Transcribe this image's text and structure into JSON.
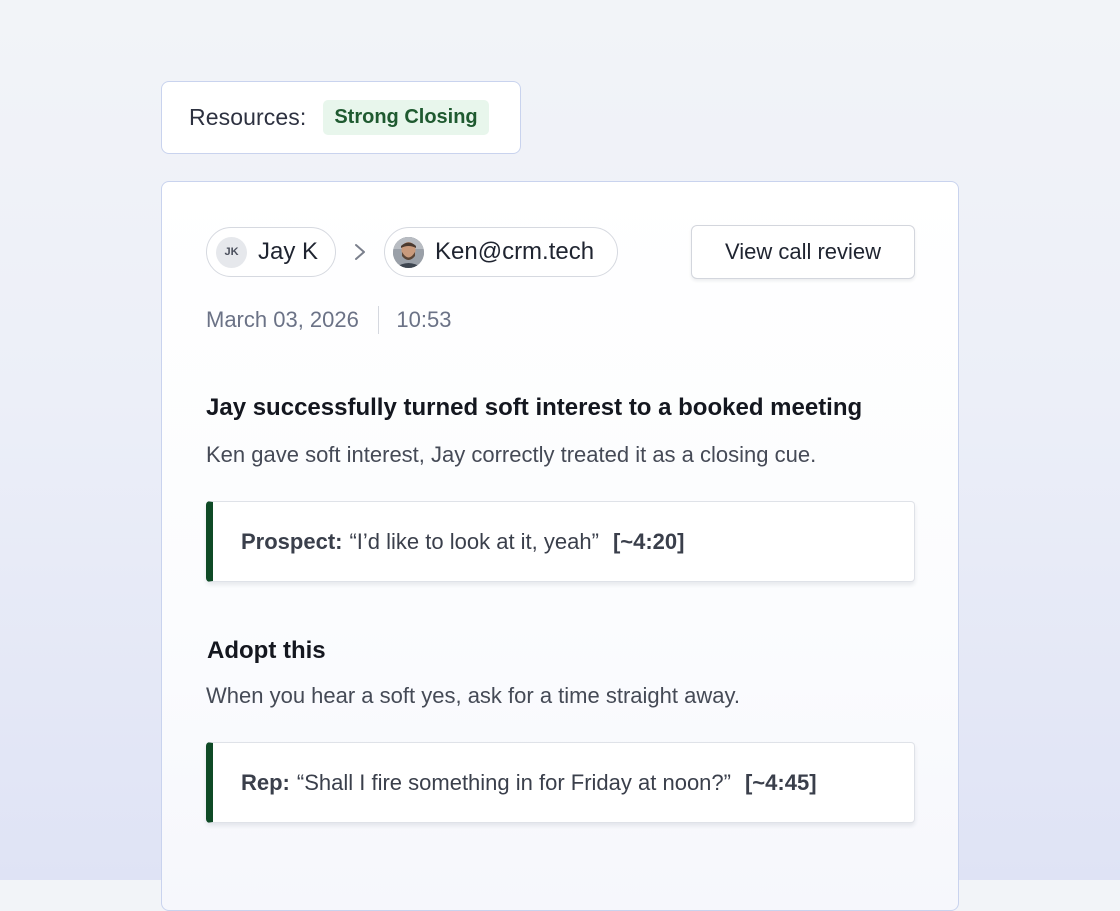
{
  "resources": {
    "label": "Resources:",
    "tag": "Strong Closing"
  },
  "call": {
    "from": {
      "initials": "JK",
      "name": "Jay K"
    },
    "to": {
      "name": "Ken@crm.tech"
    },
    "review_button": "View call review",
    "date": "March 03, 2026",
    "time": "10:53"
  },
  "insight": {
    "headline": "Jay successfully turned soft interest to a booked meeting",
    "description": "Ken gave soft interest, Jay correctly treated it as a closing cue.",
    "quote": {
      "speaker": "Prospect:",
      "text": "“I’d like to look at it, yeah”",
      "timestamp": "[~4:20]"
    }
  },
  "adopt": {
    "title": "Adopt this",
    "description": "When you hear a soft yes, ask for a time straight away.",
    "quote": {
      "speaker": "Rep:",
      "text": "“Shall I fire something in for Friday at noon?”",
      "timestamp": "[~4:45]"
    }
  },
  "colors": {
    "accent_green": "#0f4a26",
    "tag_background": "#e8f6ec",
    "card_border": "#c9d3ee"
  },
  "icons": {
    "separator": "chevron-right-icon",
    "to_avatar": "avatar-photo"
  }
}
